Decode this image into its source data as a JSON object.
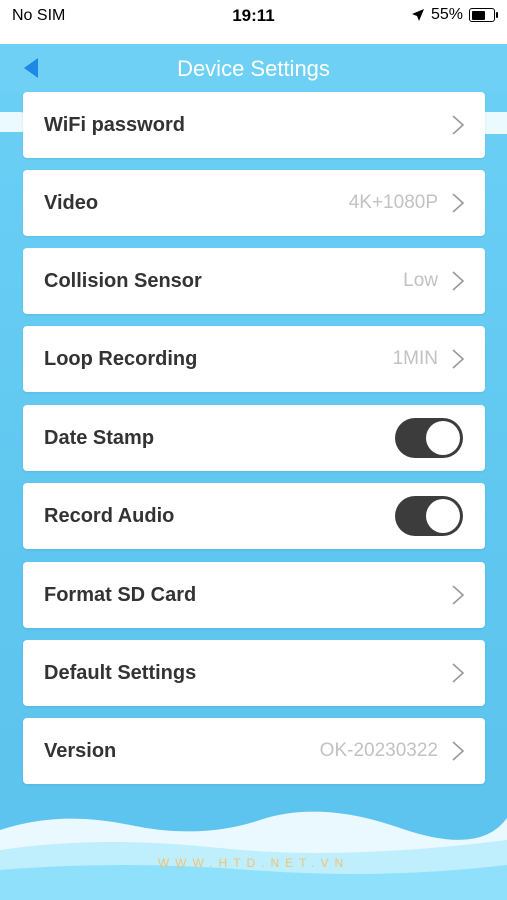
{
  "status_bar": {
    "carrier": "No SIM",
    "time": "19:11",
    "battery": "55%",
    "battery_level": 0.55,
    "location_icon": "location-arrow-icon"
  },
  "header": {
    "title": "Device Settings",
    "back_icon": "back-arrow-icon"
  },
  "settings": [
    {
      "label": "WiFi password",
      "value": "",
      "control": "chevron"
    },
    {
      "label": "Video",
      "value": "4K+1080P",
      "control": "chevron"
    },
    {
      "label": "Collision Sensor",
      "value": "Low",
      "control": "chevron"
    },
    {
      "label": "Loop Recording",
      "value": "1MIN",
      "control": "chevron"
    },
    {
      "label": "Date Stamp",
      "value": "",
      "control": "toggle",
      "on": true
    },
    {
      "label": "Record Audio",
      "value": "",
      "control": "toggle",
      "on": true
    },
    {
      "label": "Format SD Card",
      "value": "",
      "control": "chevron"
    },
    {
      "label": "Default Settings",
      "value": "",
      "control": "chevron"
    },
    {
      "label": "Version",
      "value": "OK-20230322",
      "control": "chevron"
    }
  ],
  "watermark": "WWW.HTD.NET.VN",
  "colors": {
    "header_bg": "#6ed0f5",
    "accent_blue": "#1e88e5",
    "toggle_on": "#3c3c3c"
  }
}
